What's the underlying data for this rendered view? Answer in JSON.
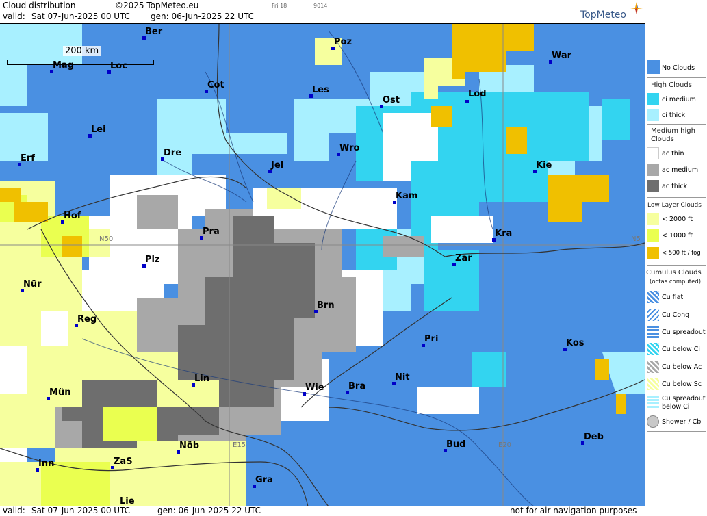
{
  "header": {
    "title": "Cloud distribution",
    "copyright": "©2025 TopMeteo.eu",
    "small_1": "Fri 18",
    "small_2": "9014",
    "valid_label": "valid:",
    "valid_value": "Sat  07-Jun-2025  00 UTC",
    "gen_value": "gen: 06-Jun-2025 22 UTC",
    "logo": "TopMeteo"
  },
  "footer": {
    "valid_label": "valid:",
    "valid_value": "Sat  07-Jun-2025  00 UTC",
    "gen_value": "gen: 06-Jun-2025 22 UTC",
    "disclaimer": "not for air navigation purposes"
  },
  "scale_label": "200 km",
  "grid_labels": [
    "N50",
    "N5",
    "E15",
    "E20"
  ],
  "cities": [
    "Ber",
    "Poz",
    "War",
    "Mag",
    "Loc",
    "Cot",
    "Les",
    "Ost",
    "Lod",
    "Lei",
    "Dre",
    "Wro",
    "Kie",
    "Erf",
    "Jel",
    "Kam",
    "Hof",
    "Pra",
    "Kra",
    "Plz",
    "Zar",
    "Nür",
    "Brn",
    "Reg",
    "Pri",
    "Kos",
    "Lin",
    "Nit",
    "Mün",
    "Wie",
    "Bra",
    "Bud",
    "Deb",
    "Nöb",
    "Inn",
    "ZaS",
    "Gra",
    "Lie"
  ],
  "legend": {
    "no_clouds": "No Clouds",
    "high_head": "High Clouds",
    "ci_medium": "ci medium",
    "ci_thick": "ci thick",
    "medium_head_1": "Medium high",
    "medium_head_2": "Clouds",
    "ac_thin": "ac thin",
    "ac_medium": "ac medium",
    "ac_thick": "ac thick",
    "low_head": "Low Layer Clouds",
    "low_2000": "< 2000 ft",
    "low_1000": "< 1000 ft",
    "low_500": "< 500 ft / fog",
    "cu_head_1": "Cumulus Clouds",
    "cu_head_2": "(octas computed)",
    "cu_flat": "Cu flat",
    "cu_cong": "Cu Cong",
    "cu_spread": "Cu spreadout",
    "cu_below_ci": "Cu below Ci",
    "cu_below_ac": "Cu below Ac",
    "cu_below_sc": "Cu below Sc",
    "cu_spread_ci_1": "Cu spreadout",
    "cu_spread_ci_2": "below Ci",
    "shower": "Shower / Cb"
  },
  "colors": {
    "no_clouds": "#4a90e2",
    "ci_medium": "#33d4f0",
    "ci_thick": "#a8f0ff",
    "ac_thin": "#ffffff",
    "ac_medium": "#a8a8a8",
    "ac_thick": "#6e6e6e",
    "low_2000": "#f6ff9e",
    "low_1000": "#eaff50",
    "low_500": "#f0c000"
  }
}
